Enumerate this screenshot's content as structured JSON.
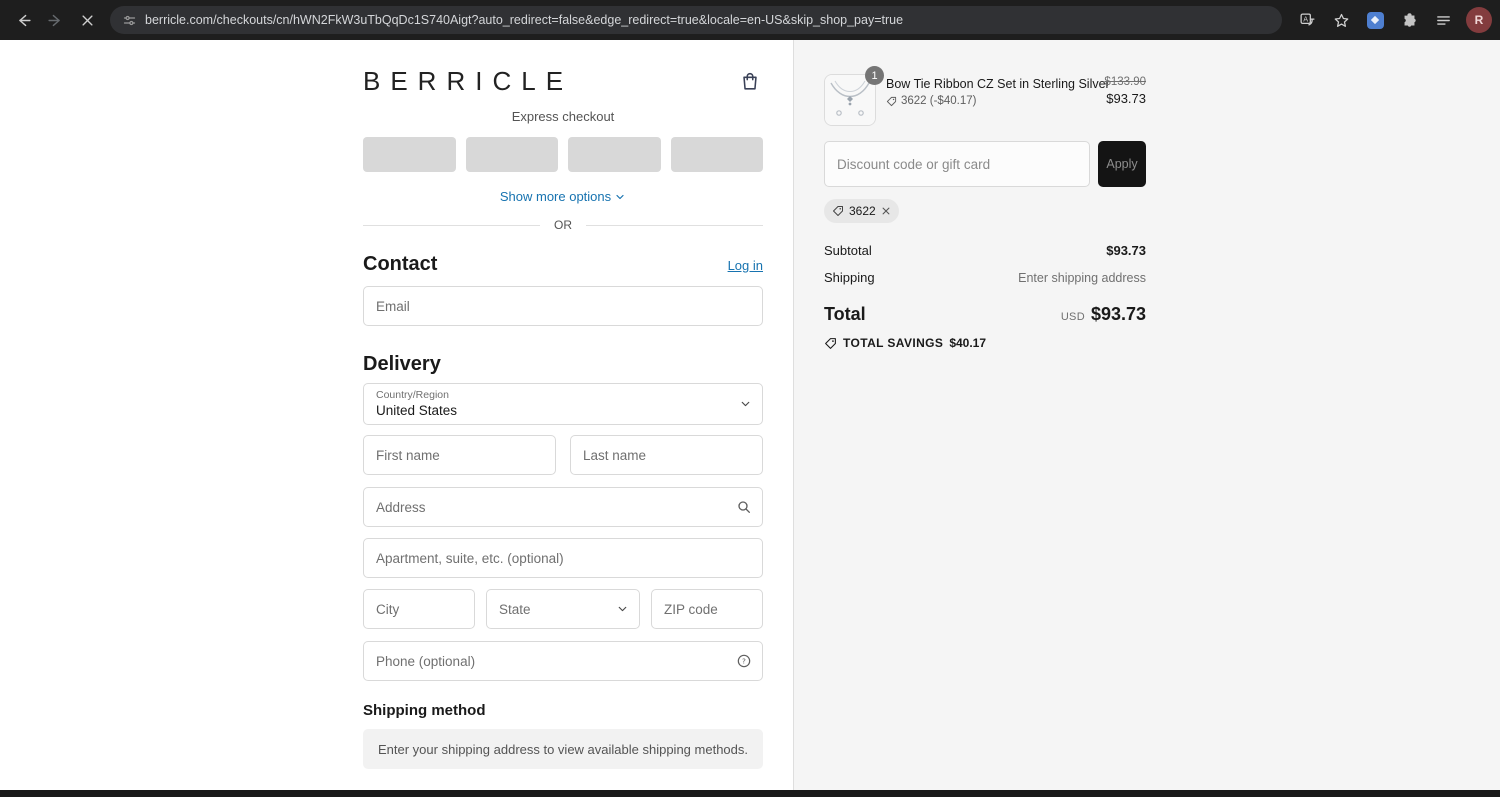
{
  "browser": {
    "url": "berricle.com/checkouts/cn/hWN2FkW3uTbQqDc1S740Aigt?auto_redirect=false&edge_redirect=true&locale=en-US&skip_shop_pay=true",
    "profile_initial": "R"
  },
  "colors": {
    "link_blue": "#1773b0",
    "brand_bag": "#3a4157",
    "apply_button_bg": "#141414",
    "sidebar_bg": "#f5f5f5"
  },
  "icons": [
    "back-icon",
    "forward-icon",
    "stop-icon",
    "site-info-icon",
    "translate-icon",
    "bookmark-star-icon",
    "extension-icon",
    "puzzle-icon",
    "menu-lines-icon",
    "bag-icon",
    "chevron-down-icon",
    "search-icon",
    "help-icon",
    "tag-icon",
    "close-icon"
  ],
  "header": {
    "logo": "BERRICLE"
  },
  "express": {
    "title": "Express checkout",
    "show_more": "Show more options",
    "or": "OR"
  },
  "contact": {
    "title": "Contact",
    "login": "Log in",
    "email_placeholder": "Email"
  },
  "delivery": {
    "title": "Delivery",
    "country_label": "Country/Region",
    "country_value": "United States",
    "first_name_placeholder": "First name",
    "last_name_placeholder": "Last name",
    "address_placeholder": "Address",
    "apartment_placeholder": "Apartment, suite, etc. (optional)",
    "city_placeholder": "City",
    "state_placeholder": "State",
    "zip_placeholder": "ZIP code",
    "phone_placeholder": "Phone (optional)"
  },
  "shipping_method": {
    "title": "Shipping method",
    "notice": "Enter your shipping address to view available shipping methods."
  },
  "summary": {
    "item": {
      "qty": "1",
      "title": "Bow Tie Ribbon CZ Set in Sterling Silver",
      "discount_label": "3622 (-$40.17)",
      "price_original": "$133.90",
      "price_current": "$93.73"
    },
    "discount": {
      "placeholder": "Discount code or gift card",
      "apply": "Apply",
      "chip": "3622"
    },
    "totals": {
      "subtotal_label": "Subtotal",
      "subtotal_value": "$93.73",
      "shipping_label": "Shipping",
      "shipping_value": "Enter shipping address",
      "total_label": "Total",
      "currency": "USD",
      "total_value": "$93.73",
      "savings_label": "TOTAL SAVINGS",
      "savings_value": "$40.17"
    }
  }
}
